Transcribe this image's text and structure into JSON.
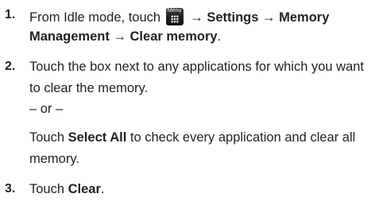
{
  "steps": [
    {
      "num": "1.",
      "pre": "From Idle mode, touch",
      "icon_label": "Menu",
      "icon": "menu-grid-icon",
      "path_1": "→ Settings → Memory",
      "path_2": "Management → Clear memory",
      "end": "."
    },
    {
      "num": "2.",
      "line_1": "Touch the box next to any applications for which you want",
      "line_2": "to clear the memory.",
      "or": "– or –",
      "alt_pre": "Touch",
      "alt_bold": "Select All",
      "alt_post": "to check every application and clear all",
      "alt_line_2": "memory."
    },
    {
      "num": "3.",
      "pre": "Touch",
      "bold": "Clear",
      "end": "."
    }
  ]
}
